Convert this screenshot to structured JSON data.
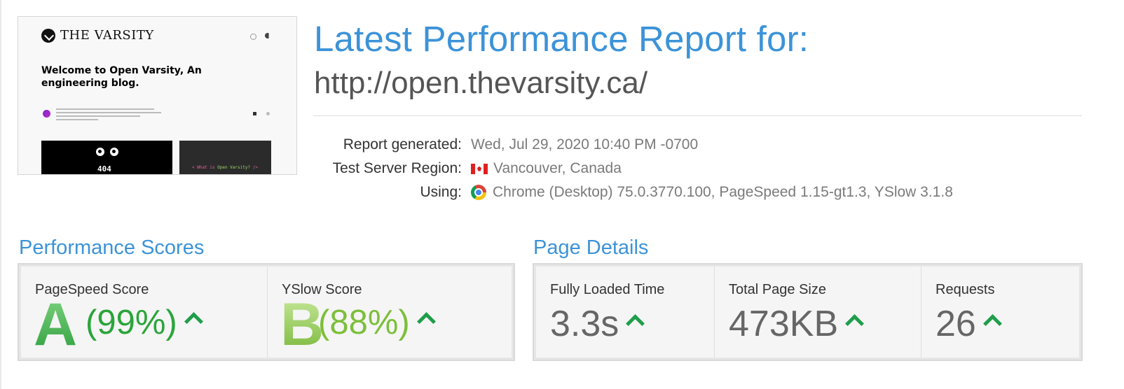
{
  "thumbnail": {
    "site_name": "THE VARSITY",
    "headline": "Welcome to Open Varsity, An engineering blog.",
    "card_404": "404",
    "card_code": [
      "< What is ",
      "Open Varsity?",
      " />"
    ]
  },
  "header": {
    "title": "Latest Performance Report for:",
    "url": "http://open.thevarsity.ca/"
  },
  "meta": [
    {
      "label": "Report generated:",
      "value": "Wed, Jul 29, 2020 10:40 PM -0700",
      "icon": ""
    },
    {
      "label": "Test Server Region:",
      "value": "Vancouver, Canada",
      "icon": "canada-flag-icon"
    },
    {
      "label": "Using:",
      "value": "Chrome (Desktop) 75.0.3770.100, PageSpeed 1.15-gt1.3, YSlow 3.1.8",
      "icon": "chrome-icon"
    }
  ],
  "performance": {
    "title": "Performance Scores",
    "pagespeed": {
      "label": "PageSpeed Score",
      "grade": "A",
      "percent": "(99%)",
      "trend": "up"
    },
    "yslow": {
      "label": "YSlow Score",
      "grade": "B",
      "percent": "(88%)",
      "trend": "up"
    }
  },
  "details": {
    "title": "Page Details",
    "fully_loaded": {
      "label": "Fully Loaded Time",
      "value": "3.3s",
      "trend": "up"
    },
    "page_size": {
      "label": "Total Page Size",
      "value": "473KB",
      "trend": "up"
    },
    "requests": {
      "label": "Requests",
      "value": "26",
      "trend": "up"
    }
  },
  "colors": {
    "accent": "#3c93d8",
    "grade_a": "#2aa53a",
    "grade_b": "#7cbf3a",
    "trend_up": "#1f9e4a"
  }
}
